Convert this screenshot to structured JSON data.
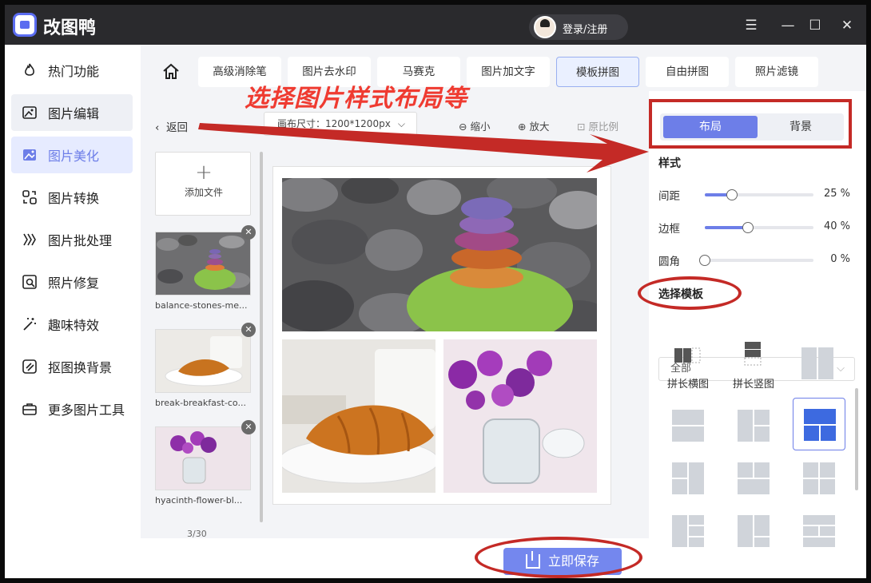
{
  "app": {
    "title": "改图鸭",
    "login_label": "登录/注册"
  },
  "window": {
    "min_icon": "minimize-icon",
    "menu_icon": "menu-icon",
    "max_icon": "maximize-icon",
    "close_icon": "close-icon"
  },
  "sidebar": {
    "items": [
      {
        "label": "热门功能",
        "icon": "fire-icon"
      },
      {
        "label": "图片编辑",
        "icon": "image-edit-icon"
      },
      {
        "label": "图片美化",
        "icon": "image-beautify-icon"
      },
      {
        "label": "图片转换",
        "icon": "convert-icon"
      },
      {
        "label": "图片批处理",
        "icon": "batch-icon"
      },
      {
        "label": "照片修复",
        "icon": "photo-repair-icon"
      },
      {
        "label": "趣味特效",
        "icon": "magic-wand-icon"
      },
      {
        "label": "抠图换背景",
        "icon": "cutout-icon"
      },
      {
        "label": "更多图片工具",
        "icon": "toolbox-icon"
      }
    ],
    "selected": "图片美化"
  },
  "tabs": [
    "高级消除笔",
    "图片去水印",
    "马赛克",
    "图片加文字",
    "模板拼图",
    "自由拼图",
    "照片滤镜"
  ],
  "active_tab": "模板拼图",
  "annotation": {
    "text": "选择图片样式布局等",
    "color": "#ef3b31"
  },
  "toolbar": {
    "back": "返回",
    "canvas_size": "画布尺寸：1200*1200px",
    "zoom_out": "缩小",
    "zoom_in": "放大",
    "original_ratio": "原比例"
  },
  "files": {
    "add_label": "添加文件",
    "items": [
      {
        "name": "balance-stones-me..."
      },
      {
        "name": "break-breakfast-co..."
      },
      {
        "name": "hyacinth-flower-bl..."
      }
    ],
    "count": "3/30"
  },
  "save_button": "立即保存",
  "right_panel": {
    "seg_layout": "布局",
    "seg_background": "背景",
    "style_title": "样式",
    "sliders": [
      {
        "label": "间距",
        "value": 25,
        "unit": "%",
        "display": "25  %"
      },
      {
        "label": "边框",
        "value": 40,
        "unit": "%",
        "display": "40  %"
      },
      {
        "label": "圆角",
        "value": 0,
        "unit": "%",
        "display": "0  %"
      }
    ],
    "template_title": "选择模板",
    "template_filter": "全部",
    "template_labels": [
      "拼长横图",
      "拼长竖图"
    ]
  },
  "colors": {
    "accent": "#6d7ee8",
    "annotation_red": "#c42a26",
    "titlebar": "#2a2a2d"
  }
}
